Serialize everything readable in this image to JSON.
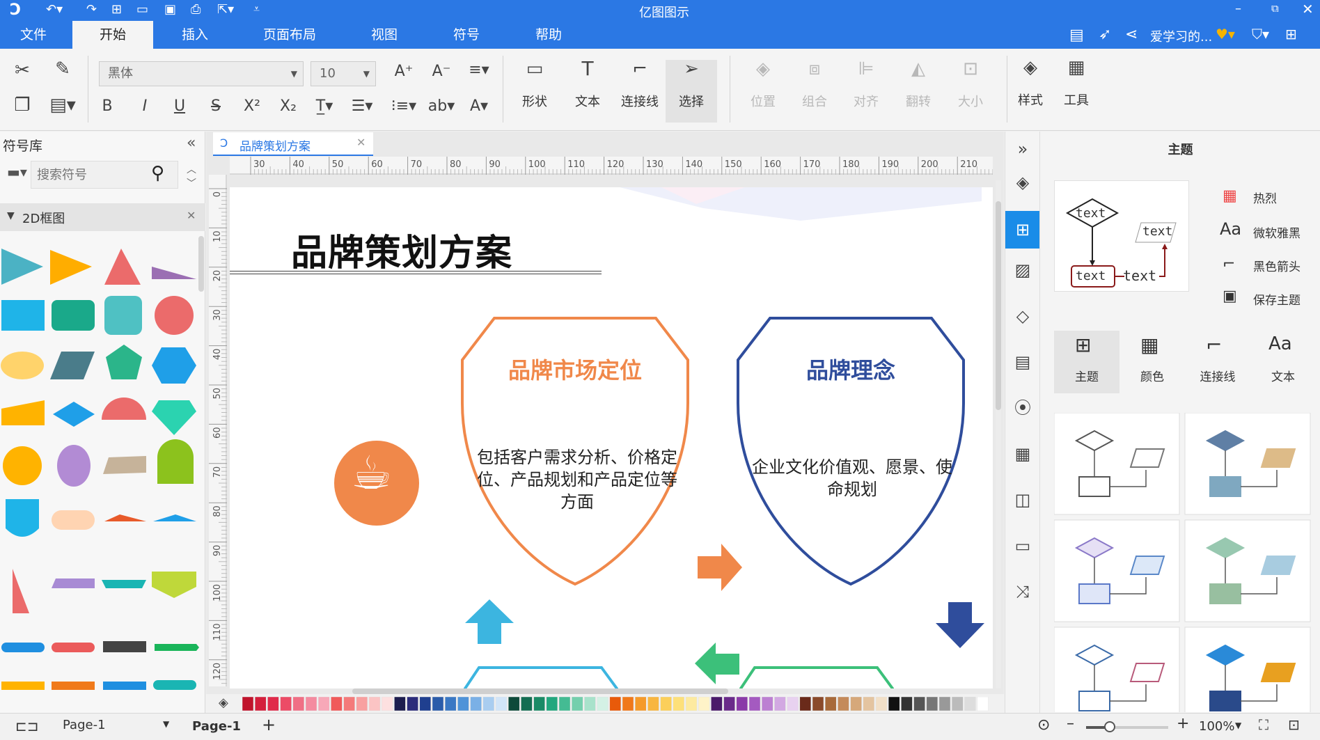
{
  "app": {
    "title": "亿图图示"
  },
  "menu": {
    "items": [
      "文件",
      "开始",
      "插入",
      "页面布局",
      "视图",
      "符号",
      "帮助"
    ],
    "active": "开始"
  },
  "user": {
    "name": "爱学习的..."
  },
  "toolbar": {
    "font_family": "黑体",
    "font_size": "10",
    "tools": [
      {
        "label": "形状",
        "icon": "shape-icon"
      },
      {
        "label": "文本",
        "icon": "text-icon"
      },
      {
        "label": "连接线",
        "icon": "connector-icon"
      },
      {
        "label": "选择",
        "icon": "select-icon"
      }
    ],
    "arrange": [
      {
        "label": "位置",
        "icon": "position-icon"
      },
      {
        "label": "组合",
        "icon": "group-icon"
      },
      {
        "label": "对齐",
        "icon": "align-icon"
      },
      {
        "label": "翻转",
        "icon": "flip-icon"
      },
      {
        "label": "大小",
        "icon": "size-icon"
      }
    ],
    "style_label": "样式",
    "tools_label": "工具"
  },
  "symbol_library": {
    "title": "符号库",
    "search_placeholder": "搜索符号",
    "category": "2D框图"
  },
  "document": {
    "tab_name": "品牌策划方案",
    "ruler_h": [
      "30",
      "40",
      "50",
      "60",
      "70",
      "80",
      "90",
      "100",
      "110",
      "120",
      "130",
      "140",
      "150",
      "160",
      "170",
      "180",
      "190",
      "200",
      "210"
    ],
    "ruler_v": [
      "0",
      "10",
      "20",
      "30",
      "40",
      "50",
      "60",
      "70",
      "80",
      "90",
      "100",
      "110",
      "120"
    ],
    "heading": "品牌策划方案",
    "shields": [
      {
        "title": "品牌市场定位",
        "body": "包括客户需求分析、价格定位、产品规划和产品定位等方面",
        "color": "#f0884a"
      },
      {
        "title": "品牌理念",
        "body": "企业文化价值观、愿景、使命规划",
        "color": "#2f4d9c"
      }
    ]
  },
  "theme_panel": {
    "title": "主题",
    "preview_texts": [
      "text",
      "text",
      "text",
      "text"
    ],
    "options": [
      {
        "label": "热烈",
        "icon": "color-grid-icon"
      },
      {
        "label": "微软雅黑",
        "icon": "font-aa-icon"
      },
      {
        "label": "黑色箭头",
        "icon": "connector-icon"
      },
      {
        "label": "保存主题",
        "icon": "save-icon"
      }
    ],
    "tabs": [
      {
        "label": "主题",
        "icon": "theme-icon"
      },
      {
        "label": "颜色",
        "icon": "color-icon"
      },
      {
        "label": "连接线",
        "icon": "connector-icon"
      },
      {
        "label": "文本",
        "icon": "text-aa-icon"
      }
    ]
  },
  "status": {
    "page_select": "Page-1",
    "page_tab": "Page-1",
    "zoom": "100%"
  },
  "colors": {
    "accent": "#2b78e4",
    "orange": "#f0884a",
    "navy": "#2f4d9c"
  }
}
